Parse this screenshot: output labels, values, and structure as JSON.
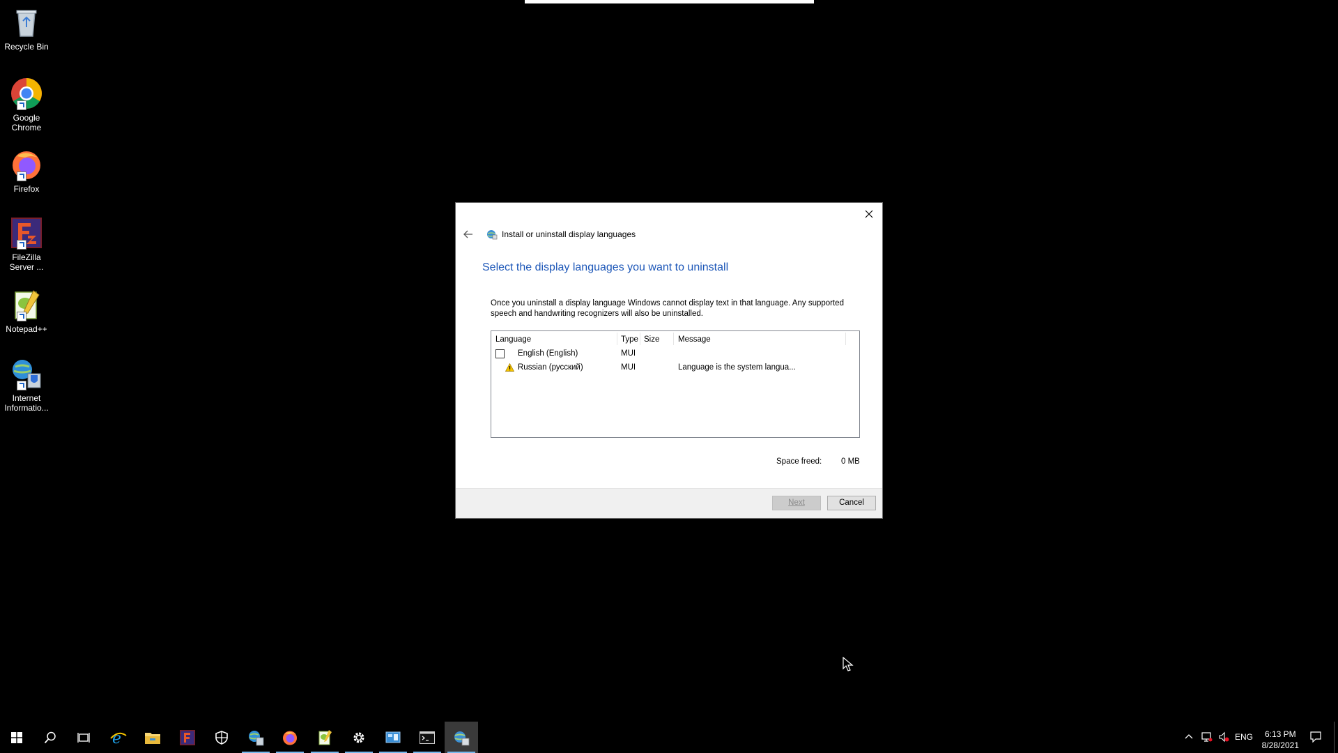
{
  "desktop_icons": [
    {
      "label": "Recycle Bin",
      "icon": "recycle-bin-icon"
    },
    {
      "label": "Google Chrome",
      "icon": "chrome-icon"
    },
    {
      "label": "Firefox",
      "icon": "firefox-icon"
    },
    {
      "label": "FileZilla Server ...",
      "icon": "filezilla-server-icon"
    },
    {
      "label": "Notepad++",
      "icon": "notepad-plus-plus-icon"
    },
    {
      "label": "Internet Informatio...",
      "icon": "iis-manager-icon"
    }
  ],
  "dialog": {
    "nav_title": "Install or uninstall display languages",
    "heading": "Select the display languages you want to uninstall",
    "description": "Once you uninstall a display language Windows cannot display text in that language. Any supported speech and handwriting recognizers will also be uninstalled.",
    "columns": [
      "Language",
      "Type",
      "Size",
      "Message"
    ],
    "rows": [
      {
        "language": "English (English)",
        "type": "MUI",
        "size": "",
        "message": "",
        "checkbox": true,
        "checked": false
      },
      {
        "language": "Russian (русский)",
        "type": "MUI",
        "size": "",
        "message": "Language is the system langua...",
        "warning_icon": "warning-icon"
      }
    ],
    "space_freed_label": "Space freed:",
    "space_freed_value": "0 MB",
    "next_label": "Next",
    "cancel_label": "Cancel"
  },
  "taskbar": {
    "items": [
      {
        "name": "start-button",
        "icon": "windows-icon"
      },
      {
        "name": "search-button",
        "icon": "search-icon"
      },
      {
        "name": "task-view-button",
        "icon": "task-view-icon"
      },
      {
        "name": "internet-explorer-button",
        "icon": "ie-icon"
      },
      {
        "name": "file-explorer-button",
        "icon": "folder-icon"
      },
      {
        "name": "filezilla-button",
        "icon": "filezilla-icon"
      },
      {
        "name": "windows-security-button",
        "icon": "shield-icon"
      },
      {
        "name": "iis-button",
        "icon": "iis-icon",
        "running": true
      },
      {
        "name": "firefox-button",
        "icon": "firefox-icon",
        "running": true
      },
      {
        "name": "notepad-plus-plus-button",
        "icon": "notepad-plus-plus-icon",
        "running": true
      },
      {
        "name": "settings-button",
        "icon": "gear-icon",
        "running": true
      },
      {
        "name": "control-panel-button",
        "icon": "control-panel-icon",
        "running": true
      },
      {
        "name": "command-prompt-button",
        "icon": "cmd-icon",
        "running": true
      },
      {
        "name": "language-dialog-button",
        "icon": "language-icon",
        "running": true,
        "active": true
      }
    ],
    "tray": {
      "language": "ENG",
      "time": "6:13 PM",
      "date": "8/28/2021"
    }
  },
  "colors": {
    "heading_blue": "#1d57b8",
    "taskbar_running": "#76b9ed",
    "warning_yellow": "#f5c400"
  }
}
